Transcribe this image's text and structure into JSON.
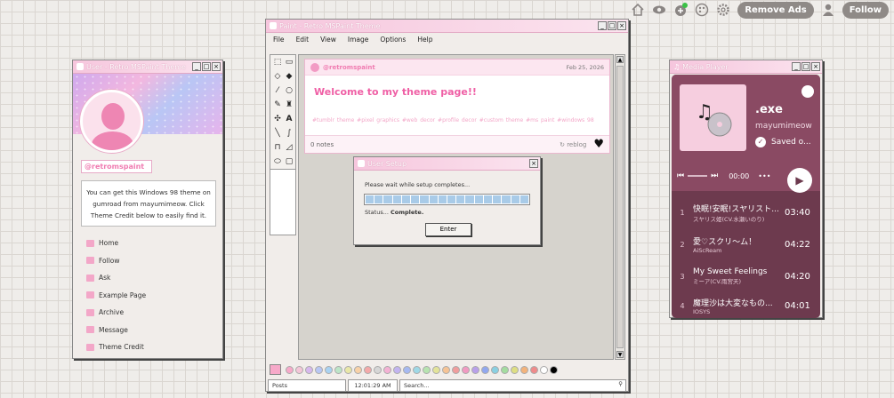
{
  "topbar": {
    "remove_ads": "Remove Ads",
    "follow": "Follow",
    "icons": [
      "home-icon",
      "eye-icon",
      "add-chat-icon",
      "palette-icon",
      "gear-icon",
      "user-icon"
    ],
    "notification_color": "#3ac146"
  },
  "profile": {
    "title": "User - Retro MSPaint Theme",
    "username": "@retromspaint",
    "description": "You can get this Windows 98 theme on gumroad from mayumimeow. Click Theme Credit below to easily find it.",
    "nav": [
      {
        "label": "Home"
      },
      {
        "label": "Follow"
      },
      {
        "label": "Ask"
      },
      {
        "label": "Example Page"
      },
      {
        "label": "Archive"
      },
      {
        "label": "Message"
      },
      {
        "label": "Theme Credit"
      }
    ]
  },
  "paint": {
    "title": "Paint - Retro MSPaint Theme",
    "menu": [
      "File",
      "Edit",
      "View",
      "Image",
      "Options",
      "Help"
    ],
    "post": {
      "author": "@retromspaint",
      "date": "Feb 25, 2026",
      "title": "Welcome to my theme page!!",
      "tags": "#tumblr theme  #pixel graphics  #web decor  #profile decor  #custom theme  #ms paint  #windows 98",
      "notes": "0 notes",
      "reblog": "reblog"
    },
    "status": {
      "section": "Posts",
      "time": "12:01:29 AM",
      "search_placeholder": "Search..."
    },
    "palette": [
      "#f7a9c9",
      "#f4c6d8",
      "#d7b8ee",
      "#b8c7f4",
      "#a9d2f2",
      "#bde5c8",
      "#e9e7a8",
      "#f8d1a7",
      "#f4a9a9",
      "#d6d6d6",
      "#f4b2d4",
      "#c2b4f0",
      "#a6b9f1",
      "#9fd8e6",
      "#b7e3b0",
      "#e3e39a",
      "#f6c395",
      "#f09d9d",
      "#f19ac2",
      "#b9a0ea",
      "#92a8ef",
      "#8ad0e2",
      "#a4dca0",
      "#dede84",
      "#f3b37c",
      "#ef8b8b",
      "#ffffff",
      "#000000"
    ]
  },
  "dialog": {
    "title": "User Setup",
    "message": "Please wait while setup completes...",
    "status_label": "Status...",
    "status_value": "Complete.",
    "button": "Enter"
  },
  "media": {
    "title": "Media Player",
    "song": ".exe",
    "artist": "mayumimeow",
    "saved": "Saved o...",
    "time": "00:00",
    "tracks": [
      {
        "n": "1",
        "title": "快眠!安眠!スヤリスト...",
        "artist": "スヤリス姫(CV.水瀬いのり)",
        "dur": "03:40"
      },
      {
        "n": "2",
        "title": "愛♡スクリ～ム！",
        "artist": "AiScReam",
        "dur": "04:22"
      },
      {
        "n": "3",
        "title": "My Sweet Feelings",
        "artist": "ミーア(CV.雨宮天)",
        "dur": "04:20"
      },
      {
        "n": "4",
        "title": "魔理沙は大変なもの...",
        "artist": "IOSYS",
        "dur": "04:01"
      }
    ]
  }
}
